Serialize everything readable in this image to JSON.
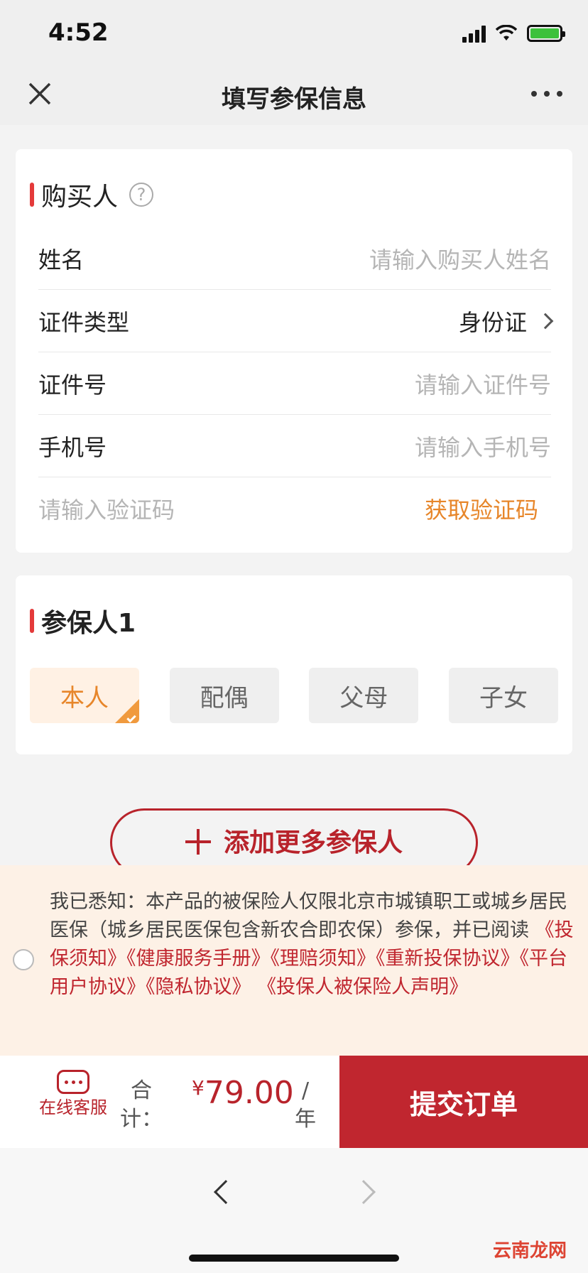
{
  "status_bar": {
    "time": "4:52"
  },
  "nav": {
    "title": "填写参保信息"
  },
  "buyer": {
    "section_title": "购买人",
    "rows": [
      {
        "label": "姓名",
        "placeholder": "请输入购买人姓名"
      },
      {
        "label": "证件类型",
        "value": "身份证"
      },
      {
        "label": "证件号",
        "placeholder": "请输入证件号"
      },
      {
        "label": "手机号",
        "placeholder": "请输入手机号"
      }
    ],
    "code_placeholder": "请输入验证码",
    "code_button": "获取验证码"
  },
  "insured": {
    "section_title": "参保人1",
    "relations": [
      "本人",
      "配偶",
      "父母",
      "子女"
    ],
    "selected_relation": "本人"
  },
  "add_more_label": "添加更多参保人",
  "notice": {
    "text_before": "我已悉知：本产品的被保险人仅限北京市城镇职工或城乡居民医保（城乡居民医保包含新农合即农保）参保，并已阅读",
    "links": [
      "《投保须知》",
      "《健康服务手册》",
      "《理赔须知》",
      "《重新投保协议》",
      "《平台用户协议》",
      "《隐私协议》",
      "《投保人被保险人声明》"
    ]
  },
  "footer": {
    "customer_service": "在线客服",
    "total_label": "合计：",
    "currency": "¥",
    "price": "79.00",
    "per_year": "/年",
    "submit": "提交订单"
  },
  "watermark": "云南龙网",
  "colors": {
    "brand_red": "#c0262f",
    "accent_orange": "#e7862a",
    "notice_bg": "#fdf1e6"
  }
}
